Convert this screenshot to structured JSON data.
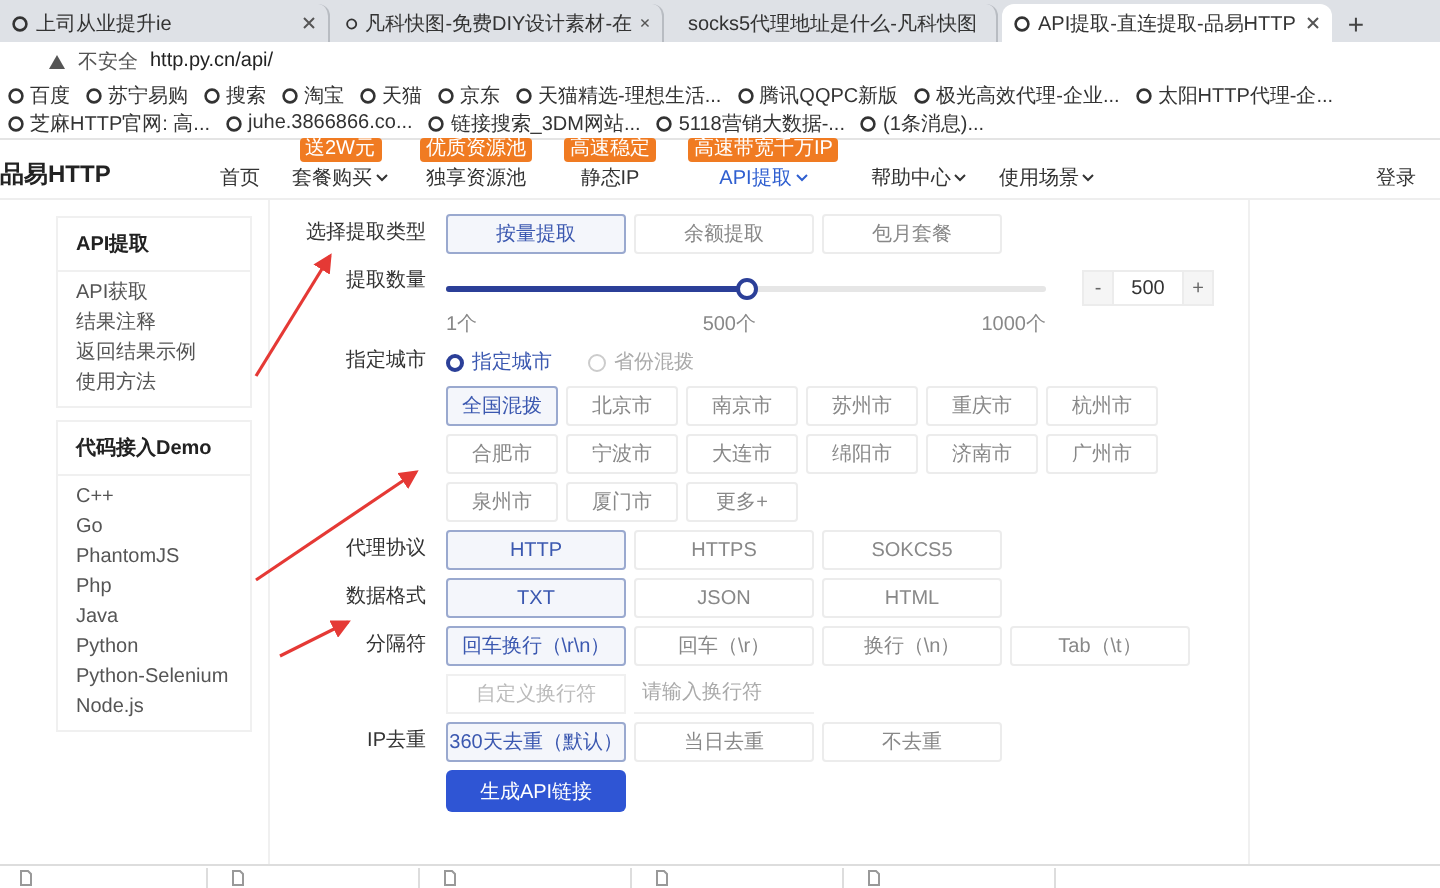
{
  "browser": {
    "tabs": [
      {
        "title": "上司从业提升ie",
        "selected": false
      },
      {
        "title": "凡科快图-免费DIY设计素材-在",
        "selected": false
      },
      {
        "title": "socks5代理地址是什么-凡科快图",
        "selected": false
      },
      {
        "title": "API提取-直连提取-品易HTTP",
        "selected": true
      }
    ],
    "new_tab": "+",
    "address": {
      "warning": "不安全",
      "url": "http.py.cn/api/"
    },
    "bookmarks": [
      "百度",
      "苏宁易购",
      "搜索",
      "淘宝",
      "天猫",
      "京东",
      "天猫精选-理想生活...",
      "腾讯QQPC新版",
      "极光高效代理-企业...",
      "太阳HTTP代理-企...",
      "芝麻HTTP官网: 高...",
      "juhe.3866866.co...",
      "链接搜索_3DM网站...",
      "5118营销大数据-...",
      "(1条消息)..."
    ]
  },
  "site_nav": {
    "logo": "品易HTTP",
    "items": [
      {
        "label": "首页",
        "dropdown": false,
        "selected": false
      },
      {
        "label": "套餐购买",
        "badge": "送2W元",
        "dropdown": true,
        "selected": false
      },
      {
        "label": "独享资源池",
        "badge": "优质资源池",
        "dropdown": false,
        "selected": false
      },
      {
        "label": "静态IP",
        "badge": "高速稳定",
        "dropdown": false,
        "selected": false
      },
      {
        "label": "API提取",
        "badge": "高速带宽千万IP",
        "dropdown": true,
        "selected": true
      },
      {
        "label": "帮助中心",
        "dropdown": true,
        "selected": false
      },
      {
        "label": "使用场景",
        "dropdown": true,
        "selected": false
      }
    ],
    "login": "登录"
  },
  "sidebar": {
    "sections": [
      {
        "title": "API提取",
        "items": [
          "API获取",
          "结果注释",
          "返回结果示例",
          "使用方法"
        ]
      },
      {
        "title": "代码接入Demo",
        "items": [
          "C++",
          "Go",
          "PhantomJS",
          "Php",
          "Java",
          "Python",
          "Python-Selenium",
          "Node.js"
        ]
      }
    ]
  },
  "form": {
    "extract_type": {
      "label": "选择提取类型",
      "options": [
        {
          "label": "按量提取",
          "selected": true
        },
        {
          "label": "余额提取",
          "selected": false
        },
        {
          "label": "包月套餐",
          "selected": false
        }
      ]
    },
    "quantity": {
      "label": "提取数量",
      "level": 0.5,
      "min_label": "1个",
      "mid_label": "500个",
      "max_label": "1000个",
      "minus": "-",
      "value": "500",
      "plus": "+"
    },
    "city": {
      "label": "指定城市",
      "modes": [
        {
          "label": "指定城市",
          "selected": true
        },
        {
          "label": "省份混拨",
          "selected": false
        }
      ],
      "cities": [
        {
          "label": "全国混拨",
          "selected": true
        },
        {
          "label": "北京市",
          "selected": false
        },
        {
          "label": "南京市",
          "selected": false
        },
        {
          "label": "苏州市",
          "selected": false
        },
        {
          "label": "重庆市",
          "selected": false
        },
        {
          "label": "杭州市",
          "selected": false
        },
        {
          "label": "合肥市",
          "selected": false
        },
        {
          "label": "宁波市",
          "selected": false
        },
        {
          "label": "大连市",
          "selected": false
        },
        {
          "label": "绵阳市",
          "selected": false
        },
        {
          "label": "济南市",
          "selected": false
        },
        {
          "label": "广州市",
          "selected": false
        },
        {
          "label": "泉州市",
          "selected": false
        },
        {
          "label": "厦门市",
          "selected": false
        },
        {
          "label": "更多+",
          "selected": false
        }
      ]
    },
    "protocol": {
      "label": "代理协议",
      "options": [
        {
          "label": "HTTP",
          "selected": true
        },
        {
          "label": "HTTPS",
          "selected": false
        },
        {
          "label": "SOKCS5",
          "selected": false
        }
      ]
    },
    "format": {
      "label": "数据格式",
      "options": [
        {
          "label": "TXT",
          "selected": true
        },
        {
          "label": "JSON",
          "selected": false
        },
        {
          "label": "HTML",
          "selected": false
        }
      ]
    },
    "separator": {
      "label": "分隔符",
      "options": [
        {
          "label": "回车换行（\\r\\n）",
          "selected": true
        },
        {
          "label": "回车（\\r）",
          "selected": false
        },
        {
          "label": "换行（\\n）",
          "selected": false
        },
        {
          "label": "Tab（\\t）",
          "selected": false
        }
      ],
      "custom": {
        "label": "自定义换行符",
        "disabled": true
      },
      "custom_input": {
        "placeholder": "请输入换行符"
      }
    },
    "dedupe": {
      "label": "IP去重",
      "options": [
        {
          "label": "360天去重（默认）",
          "selected": true
        },
        {
          "label": "当日去重",
          "selected": false
        },
        {
          "label": "不去重",
          "selected": false
        }
      ]
    },
    "submit": "生成API链接"
  }
}
